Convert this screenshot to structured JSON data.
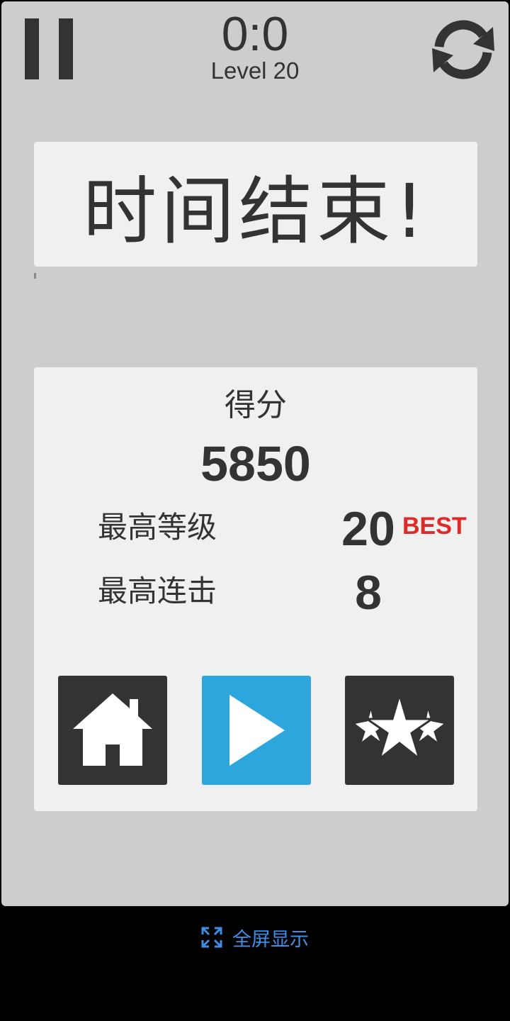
{
  "hud": {
    "timer": "0:0",
    "level": "Level 20",
    "pause_icon": "pause-icon",
    "restart_icon": "refresh-icon"
  },
  "message": {
    "text": "时间结束!"
  },
  "results": {
    "score_label": "得分",
    "score_value": "5850",
    "max_level_label": "最高等级",
    "max_level_value": "20",
    "best_badge": "BEST",
    "max_combo_label": "最高连击",
    "max_combo_value": "8"
  },
  "buttons": {
    "home_icon": "home-icon",
    "play_icon": "play-icon",
    "rate_icon": "stars-icon"
  },
  "fullscreen": {
    "label": "全屏显示",
    "icon": "expand-icon"
  },
  "colors": {
    "background": "#cdcdcd",
    "panel": "#f0f0f0",
    "text": "#333333",
    "play_accent": "#2ca6dd",
    "best_badge": "#e02a2a",
    "fullscreen_link": "#3d8ee6"
  }
}
